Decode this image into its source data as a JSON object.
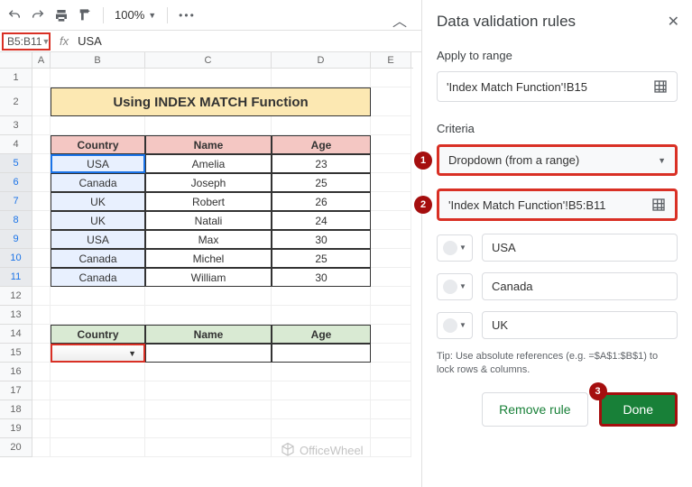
{
  "toolbar": {
    "zoom": "100%"
  },
  "fx": {
    "name_box": "B5:B11",
    "formula": "USA"
  },
  "columns": [
    "A",
    "B",
    "C",
    "D",
    "E"
  ],
  "title": "Using INDEX MATCH Function",
  "headers": [
    "Country",
    "Name",
    "Age"
  ],
  "rows": [
    {
      "country": "USA",
      "name": "Amelia",
      "age": "23"
    },
    {
      "country": "Canada",
      "name": "Joseph",
      "age": "25"
    },
    {
      "country": "UK",
      "name": "Robert",
      "age": "26"
    },
    {
      "country": "UK",
      "name": "Natali",
      "age": "24"
    },
    {
      "country": "USA",
      "name": "Max",
      "age": "30"
    },
    {
      "country": "Canada",
      "name": "Michel",
      "age": "25"
    },
    {
      "country": "Canada",
      "name": "William",
      "age": "30"
    }
  ],
  "headers2": [
    "Country",
    "Name",
    "Age"
  ],
  "panel": {
    "title": "Data validation rules",
    "apply_label": "Apply to range",
    "range": "'Index Match Function'!B15",
    "criteria_label": "Criteria",
    "criteria_type": "Dropdown (from a range)",
    "criteria_range": "'Index Match Function'!B5:B11",
    "options": [
      "USA",
      "Canada",
      "UK"
    ],
    "tip": "Tip: Use absolute references (e.g. =$A$1:$B$1) to lock rows & columns.",
    "remove": "Remove rule",
    "done": "Done",
    "badges": {
      "1": "1",
      "2": "2",
      "3": "3"
    }
  },
  "watermark": "OfficeWheel"
}
